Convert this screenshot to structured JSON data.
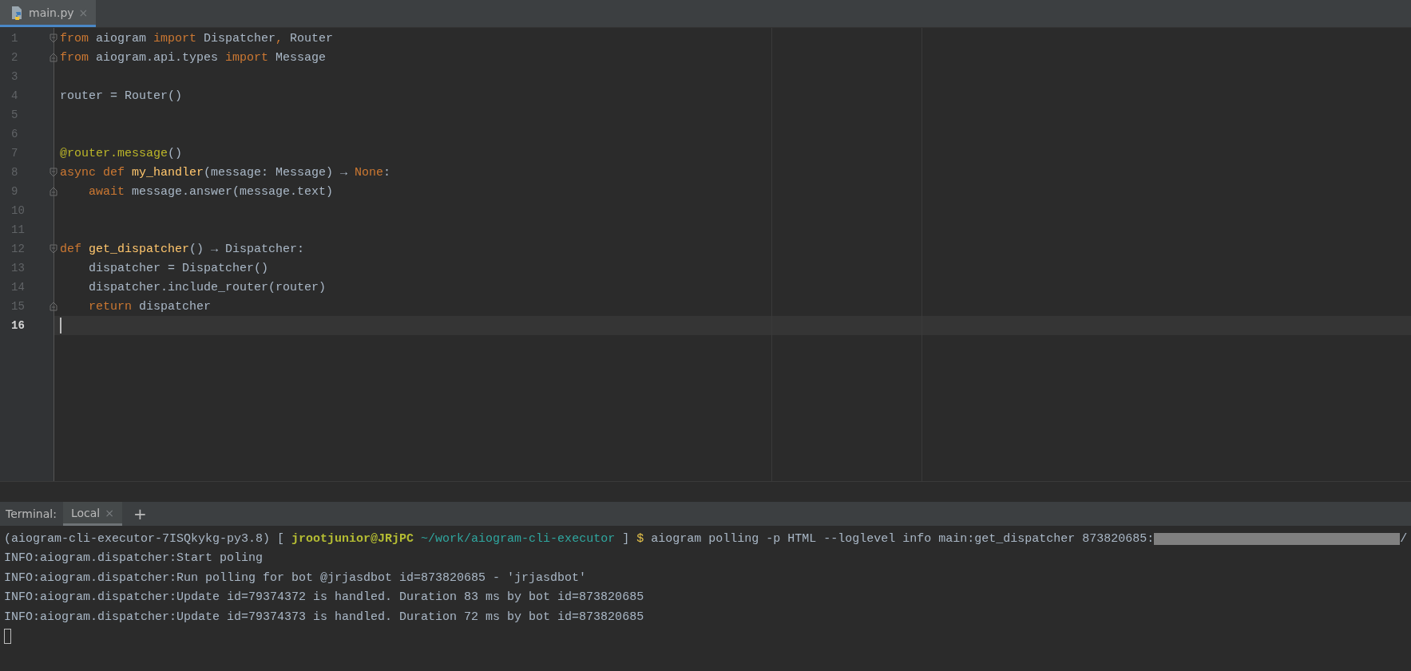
{
  "editor_tabs": [
    {
      "label": "main.py",
      "selected": true,
      "close": "×"
    }
  ],
  "code_lines": [
    {
      "number": "1",
      "fold_start": true,
      "fold_end": false,
      "indented": false,
      "current": false,
      "tokens": [
        {
          "kind": "kw",
          "text": "from"
        },
        {
          "kind": "plain",
          "text": " aiogram "
        },
        {
          "kind": "kw",
          "text": "import"
        },
        {
          "kind": "plain",
          "text": " Dispatcher"
        },
        {
          "kind": "kw",
          "text": ","
        },
        {
          "kind": "plain",
          "text": " Router"
        }
      ]
    },
    {
      "number": "2",
      "fold_start": false,
      "fold_end": true,
      "indented": false,
      "current": false,
      "tokens": [
        {
          "kind": "kw",
          "text": "from"
        },
        {
          "kind": "plain",
          "text": " aiogram.api.types "
        },
        {
          "kind": "kw",
          "text": "import"
        },
        {
          "kind": "plain",
          "text": " Message"
        }
      ]
    },
    {
      "number": "3",
      "fold_start": false,
      "fold_end": false,
      "current": false
    },
    {
      "number": "4",
      "fold_start": false,
      "fold_end": false,
      "indented": false,
      "current": false,
      "tokens": [
        {
          "kind": "plain",
          "text": "router = Router()"
        }
      ]
    },
    {
      "number": "5",
      "fold_start": false,
      "fold_end": false,
      "current": false
    },
    {
      "number": "6",
      "fold_start": false,
      "fold_end": false,
      "current": false
    },
    {
      "number": "7",
      "fold_start": false,
      "fold_end": false,
      "indented": false,
      "current": false,
      "tokens": [
        {
          "kind": "deco",
          "text": "@router.message"
        },
        {
          "kind": "plain",
          "text": "()"
        }
      ]
    },
    {
      "number": "8",
      "fold_start": true,
      "fold_end": false,
      "indented": false,
      "current": false,
      "tokens": [
        {
          "kind": "kw",
          "text": "async def "
        },
        {
          "kind": "fn",
          "text": "my_handler"
        },
        {
          "kind": "plain",
          "text": "(message: Message) → "
        },
        {
          "kind": "kw",
          "text": "None"
        },
        {
          "kind": "plain",
          "text": ":"
        }
      ]
    },
    {
      "number": "9",
      "fold_start": false,
      "fold_end": true,
      "indented": true,
      "current": false,
      "tokens": [
        {
          "kind": "kw",
          "text": "await"
        },
        {
          "kind": "plain",
          "text": " message.answer(message.text)"
        }
      ]
    },
    {
      "number": "10",
      "fold_start": false,
      "fold_end": false,
      "current": false
    },
    {
      "number": "11",
      "fold_start": false,
      "fold_end": false,
      "current": false
    },
    {
      "number": "12",
      "fold_start": true,
      "fold_end": false,
      "indented": false,
      "current": false,
      "tokens": [
        {
          "kind": "kw",
          "text": "def "
        },
        {
          "kind": "fn",
          "text": "get_dispatcher"
        },
        {
          "kind": "plain",
          "text": "() → Dispatcher:"
        }
      ]
    },
    {
      "number": "13",
      "fold_start": false,
      "fold_end": false,
      "indented": true,
      "current": false,
      "tokens": [
        {
          "kind": "plain",
          "text": "dispatcher = Dispatcher()"
        }
      ]
    },
    {
      "number": "14",
      "fold_start": false,
      "fold_end": false,
      "indented": true,
      "current": false,
      "tokens": [
        {
          "kind": "plain",
          "text": "dispatcher.include_router(router)"
        }
      ]
    },
    {
      "number": "15",
      "fold_start": false,
      "fold_end": true,
      "indented": true,
      "current": false,
      "tokens": [
        {
          "kind": "kw",
          "text": "return"
        },
        {
          "kind": "plain",
          "text": " dispatcher"
        }
      ]
    },
    {
      "number": "16",
      "fold_start": false,
      "fold_end": false,
      "indented": false,
      "current": true
    }
  ],
  "terminal": {
    "label": "Terminal:",
    "tabs": [
      {
        "label": "Local",
        "selected": true,
        "close": "×"
      }
    ],
    "add_button": "+",
    "lines": [
      [
        {
          "kind": "plain",
          "text": "(aiogram-cli-executor-7ISQkykg-py3.8) [ "
        },
        {
          "kind": "user",
          "text": "jrootjunior@JRjPC"
        },
        {
          "kind": "path",
          "text": " ~/work/aiogram-cli-executor"
        },
        {
          "kind": "plain",
          "text": " ] "
        },
        {
          "kind": "prompt",
          "text": "$"
        },
        {
          "kind": "plain",
          "text": " aiogram polling -p HTML --loglevel info main:get_dispatcher 873820685:"
        },
        {
          "kind": "redacted"
        },
        {
          "kind": "plain",
          "text": "/"
        }
      ],
      [
        {
          "kind": "plain",
          "text": "INFO:aiogram.dispatcher:Start poling"
        }
      ],
      [
        {
          "kind": "plain",
          "text": "INFO:aiogram.dispatcher:Run polling for bot @jrjasdbot id=873820685 - 'jrjasdbot'"
        }
      ],
      [
        {
          "kind": "plain",
          "text": "INFO:aiogram.dispatcher:Update id=79374372 is handled. Duration 83 ms by bot id=873820685"
        }
      ],
      [
        {
          "kind": "plain",
          "text": "INFO:aiogram.dispatcher:Update id=79374373 is handled. Duration 72 ms by bot id=873820685"
        }
      ]
    ]
  }
}
